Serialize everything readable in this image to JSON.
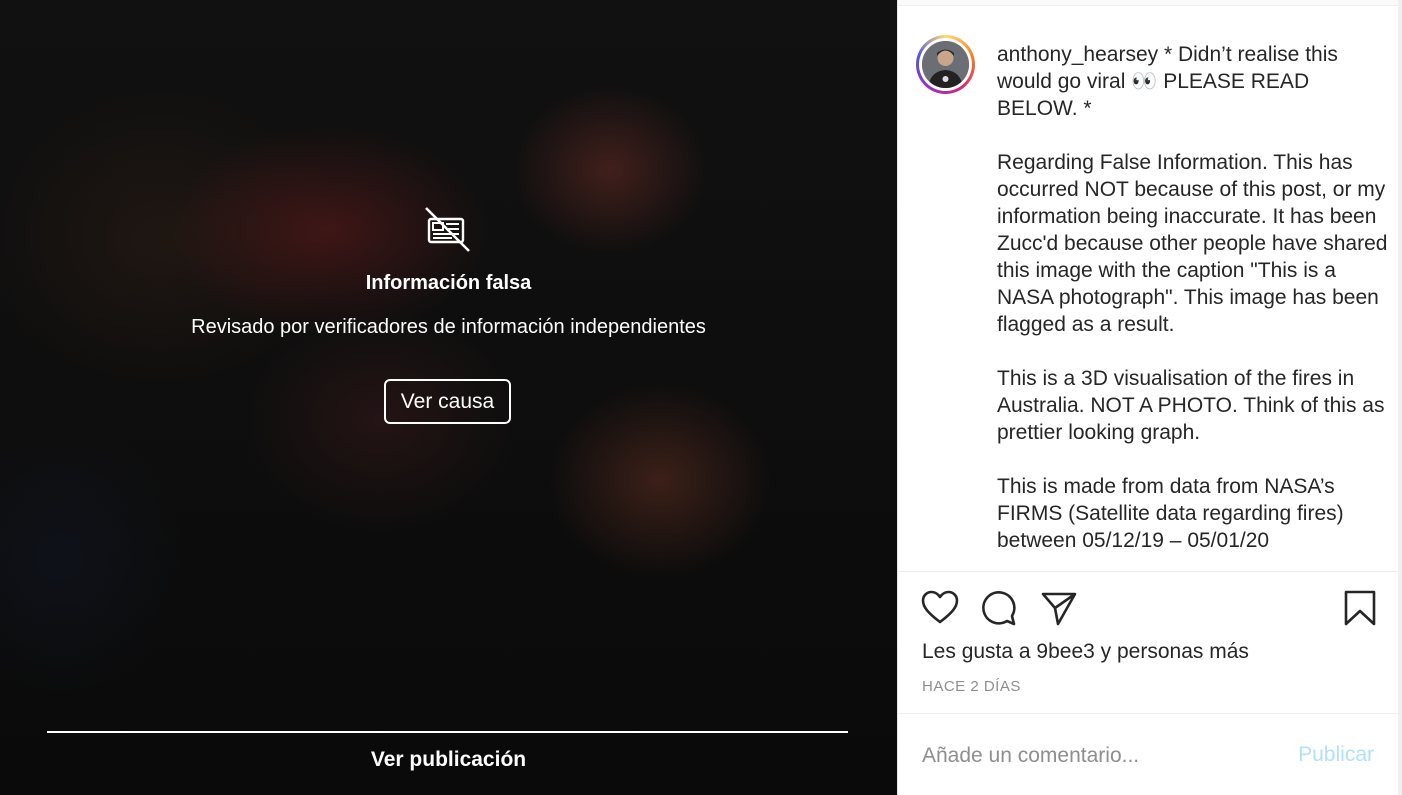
{
  "media": {
    "warning_icon": "news-crossed-icon",
    "warning_title": "Información falsa",
    "warning_subtitle": "Revisado por verificadores de información independientes",
    "cause_button": "Ver causa",
    "view_post_label": "Ver publicación"
  },
  "post": {
    "username": "anthony_hearsey",
    "avatar_icon": "user-avatar",
    "caption_paragraphs": [
      "* Didn’t realise this would go viral 👀 PLEASE READ BELOW. *",
      "Regarding False Information. This has occurred NOT because of this post, or my information being inaccurate. It has been Zucc'd because other people have shared this image with the caption \"This is a NASA photograph\". This image has been flagged as a result.",
      "This is a 3D visualisation of the fires in Australia. NOT A PHOTO. Think of this as prettier looking graph.",
      "This is made from data from NASA’s FIRMS (Satellite data regarding fires) between 05/12/19 – 05/01/20"
    ],
    "actions": {
      "like_icon": "heart-icon",
      "comment_icon": "comment-icon",
      "share_icon": "send-icon",
      "save_icon": "bookmark-icon"
    },
    "likes_text": "Les gusta a 9bee3 y personas más",
    "timestamp": "HACE 2 DÍAS",
    "comment_placeholder": "Añade un comentario...",
    "publish_label": "Publicar"
  },
  "colors": {
    "publish_disabled": "#b2dffc",
    "muted_text": "#8e8e8e",
    "text": "#262626"
  }
}
